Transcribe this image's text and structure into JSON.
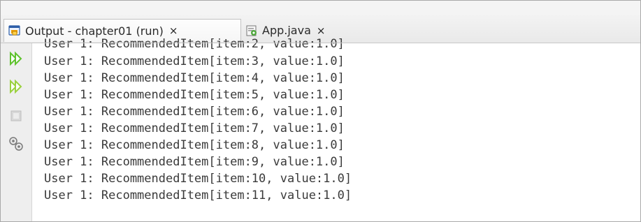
{
  "tabs": [
    {
      "label": "Output - chapter01 (run)",
      "close": "×",
      "icon": "output-window-icon"
    },
    {
      "label": "App.java",
      "close": "×",
      "icon": "java-file-icon"
    }
  ],
  "toolbar": {
    "buttons": [
      {
        "name": "rerun-icon"
      },
      {
        "name": "rerun-with-args-icon"
      },
      {
        "name": "stop-icon"
      },
      {
        "name": "settings-icon"
      }
    ]
  },
  "output": {
    "lines": [
      "User 1: RecommendedItem[item:2, value:1.0]",
      "User 1: RecommendedItem[item:3, value:1.0]",
      "User 1: RecommendedItem[item:4, value:1.0]",
      "User 1: RecommendedItem[item:5, value:1.0]",
      "User 1: RecommendedItem[item:6, value:1.0]",
      "User 1: RecommendedItem[item:7, value:1.0]",
      "User 1: RecommendedItem[item:8, value:1.0]",
      "User 1: RecommendedItem[item:9, value:1.0]",
      "User 1: RecommendedItem[item:10, value:1.0]",
      "User 1: RecommendedItem[item:11, value:1.0]"
    ]
  },
  "colors": {
    "run_green": "#5fc22e",
    "stop_gray": "#c9c9c9",
    "text": "#3a3a3a"
  }
}
